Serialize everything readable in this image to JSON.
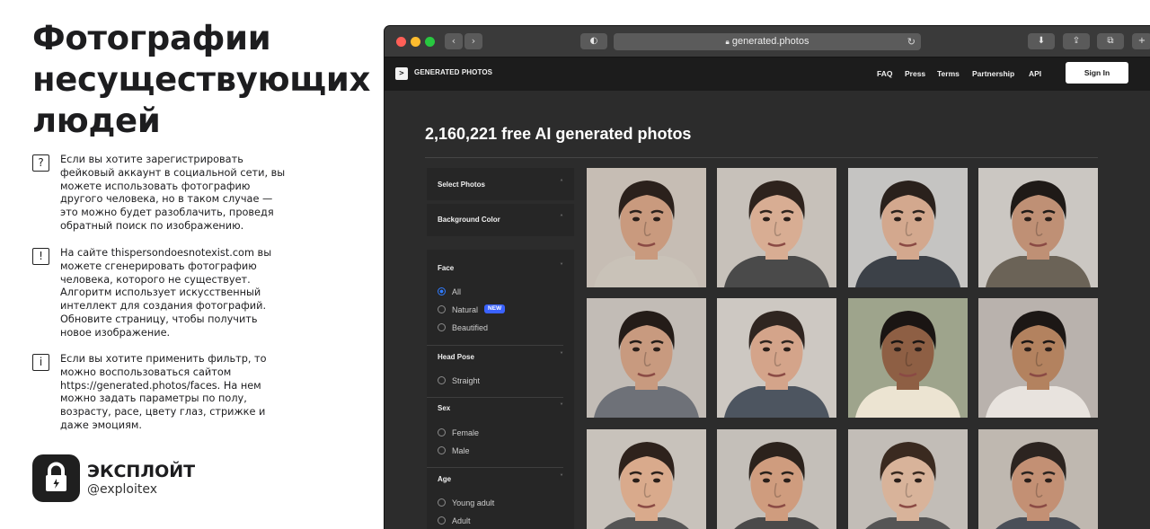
{
  "article": {
    "title_lines": [
      "Фотографии",
      "несуществующих",
      "людей"
    ],
    "tips": [
      {
        "icon": "question-icon",
        "glyph": "?",
        "lines": [
          "Если вы хотите зарегистрировать",
          "фейковый аккаунт в социальной сети, вы",
          "можете использовать фотографию",
          "другого человека, но в таком случае —",
          "это можно будет разоблачить, проведя",
          "обратный поиск по изображению."
        ]
      },
      {
        "icon": "exclamation-icon",
        "glyph": "!",
        "lines": [
          "На сайте thispersondoesnotexist.com вы",
          "можете сгенерировать фотографию",
          "человека, которого не существует.",
          "Алгоритм использует искусственный",
          "интеллект для создания фотографий.",
          "Обновите страницу, чтобы получить",
          "новое изображение."
        ]
      },
      {
        "icon": "info-icon",
        "glyph": "i",
        "lines": [
          "Если вы хотите применить фильтр, то",
          "можно воспользоваться сайтом",
          "https://generated.photos/faces. На нем",
          "можно задать параметры по полу,",
          "возрасту, расе, цвету глаз, стрижке и",
          "даже эмоциям."
        ]
      }
    ],
    "brand": {
      "name": "ЭКСПЛОЙТ",
      "handle": "@exploitex",
      "icon": "lock-icon"
    }
  },
  "browser": {
    "traffic_lights": [
      "#ff5f57",
      "#febc2e",
      "#28c840"
    ],
    "url": "generated.photos",
    "back_icon": "chevron-left-icon",
    "forward_icon": "chevron-right-icon"
  },
  "site": {
    "logo_text": "GENERATED PHOTOS",
    "nav": [
      "FAQ",
      "Press",
      "Terms",
      "Partnership",
      "API"
    ],
    "signin": "Sign In",
    "heading": "2,160,221 free AI generated photos",
    "filters": {
      "select_photos": "Select Photos",
      "background_color": "Background Color",
      "face": {
        "label": "Face",
        "options": [
          "All",
          "Natural",
          "Beautified"
        ],
        "selected": "All",
        "badge": "NEW"
      },
      "head_pose": {
        "label": "Head Pose",
        "options": [
          "Straight"
        ]
      },
      "sex": {
        "label": "Sex",
        "options": [
          "Female",
          "Male"
        ]
      },
      "age": {
        "label": "Age",
        "options": [
          "Young adult",
          "Adult"
        ]
      }
    },
    "faces": [
      {
        "bg": "#c6bdb4",
        "skin": "#c99a7e",
        "hair": "#2b211c",
        "shirt": "#c9c2b8"
      },
      {
        "bg": "#c7c1ba",
        "skin": "#d8ad93",
        "hair": "#2e231d",
        "shirt": "#4a4a4a"
      },
      {
        "bg": "#c5c4c2",
        "skin": "#d3a88e",
        "hair": "#2a211c",
        "shirt": "#3c4148"
      },
      {
        "bg": "#cbc7c2",
        "skin": "#bf9075",
        "hair": "#1f1a17",
        "shirt": "#6b6357"
      },
      {
        "bg": "#c2bcb6",
        "skin": "#c89a7f",
        "hair": "#241c18",
        "shirt": "#6e7178"
      },
      {
        "bg": "#cdc8c2",
        "skin": "#d4a48a",
        "hair": "#2f2520",
        "shirt": "#4d5560"
      },
      {
        "bg": "#9ea48c",
        "skin": "#8e5f44",
        "hair": "#1a1513",
        "shirt": "#ece4d2"
      },
      {
        "bg": "#b9b2ad",
        "skin": "#b3825f",
        "hair": "#1c1715",
        "shirt": "#e8e3de"
      },
      {
        "bg": "#c8c2bb",
        "skin": "#d9aa8c",
        "hair": "#2e221c",
        "shirt": "#555"
      },
      {
        "bg": "#c4bfb9",
        "skin": "#cf9c7e",
        "hair": "#2b221c",
        "shirt": "#4a4a4a"
      },
      {
        "bg": "#c2bdb7",
        "skin": "#d8b39a",
        "hair": "#3a2a20",
        "shirt": "#555"
      },
      {
        "bg": "#bfb8b0",
        "skin": "#c39074",
        "hair": "#2c2420",
        "shirt": "#4a4f58"
      }
    ]
  }
}
